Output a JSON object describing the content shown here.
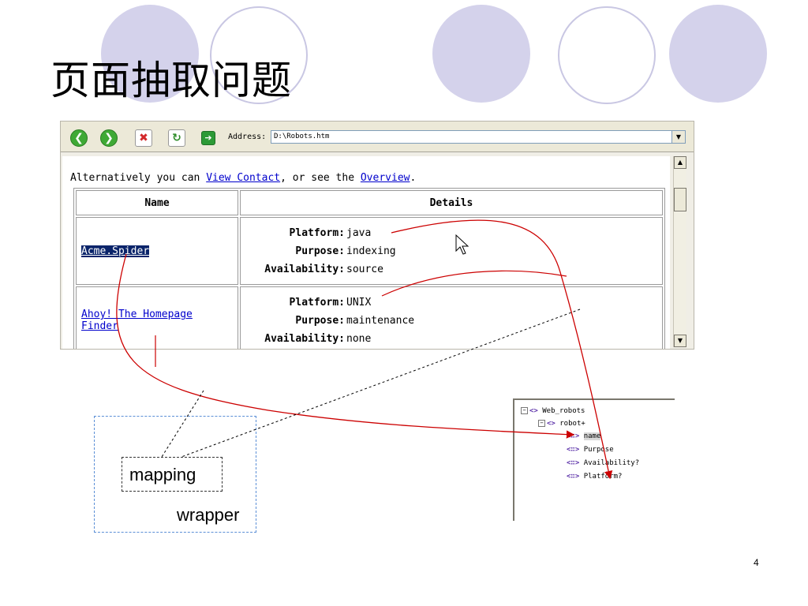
{
  "slide": {
    "title": "页面抽取问题",
    "page_number": "4"
  },
  "browser": {
    "toolbar": {
      "back_icon": "back-arrow-icon",
      "forward_icon": "forward-arrow-icon",
      "stop_icon": "stop-icon",
      "refresh_icon": "refresh-icon",
      "go_icon": "go-arrow-icon",
      "address_label": "Address:",
      "address_value": "D:\\Robots.htm"
    },
    "intro": {
      "prefix": "Alternatively you can ",
      "link1": "View Contact",
      "middle": ", or see the ",
      "link2": "Overview",
      "suffix": "."
    },
    "table": {
      "headers": [
        "Name",
        "Details"
      ],
      "rows": [
        {
          "name": "Acme.Spider",
          "details": [
            {
              "key": "Platform:",
              "value": "java"
            },
            {
              "key": "Purpose:",
              "value": "indexing"
            },
            {
              "key": "Availability:",
              "value": "source"
            }
          ]
        },
        {
          "name": "Ahoy! The Homepage Finder",
          "details": [
            {
              "key": "Platform:",
              "value": "UNIX"
            },
            {
              "key": "Purpose:",
              "value": "maintenance"
            },
            {
              "key": "Availability:",
              "value": "none"
            }
          ]
        }
      ]
    }
  },
  "tree": {
    "root": "Web_robots",
    "child": "robot+",
    "leaves": [
      "name",
      "Purpose",
      "Availability?",
      "Platform?"
    ]
  },
  "diagram": {
    "mapping_label": "mapping",
    "wrapper_label": "wrapper"
  },
  "colors": {
    "accent_circle": "#d4d2eb",
    "arrow_red": "#cc0000",
    "link_blue": "#0000cc",
    "selection": "#0a246a"
  }
}
